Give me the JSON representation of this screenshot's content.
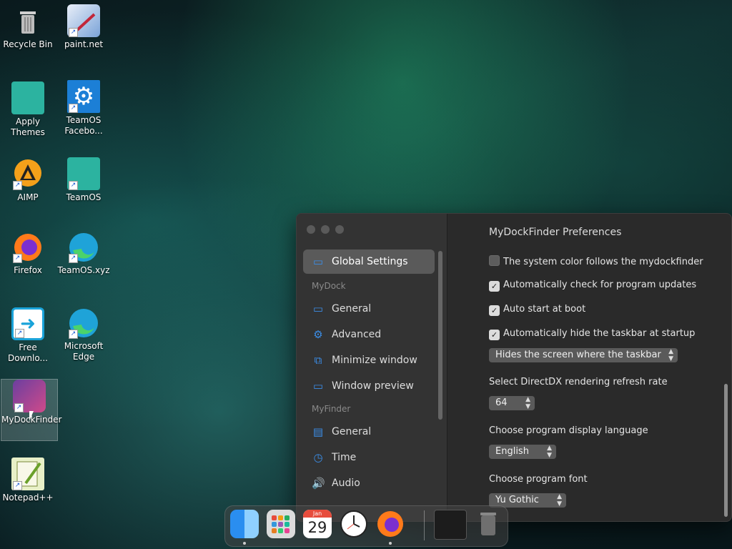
{
  "desktop": {
    "icons": [
      {
        "label": "Recycle Bin",
        "icon": "recycle-bin-icon"
      },
      {
        "label": "paint.net",
        "icon": "paint-net-icon"
      },
      {
        "label": "Apply Themes",
        "icon": "folder-icon"
      },
      {
        "label": "TeamOS Facebo...",
        "icon": "gear-icon"
      },
      {
        "label": "AIMP",
        "icon": "aimp-icon"
      },
      {
        "label": "TeamOS",
        "icon": "folder-icon"
      },
      {
        "label": "Firefox",
        "icon": "firefox-icon"
      },
      {
        "label": "TeamOS.xyz",
        "icon": "edge-icon"
      },
      {
        "label": "Free Downlo...",
        "icon": "free-download-manager-icon"
      },
      {
        "label": "Microsoft Edge",
        "icon": "edge-icon"
      },
      {
        "label": "MyDockFinder",
        "icon": "mydockfinder-icon"
      },
      {
        "label": "Notepad++",
        "icon": "notepad-plus-plus-icon"
      }
    ]
  },
  "window": {
    "title": "MyDockFinder Preferences",
    "sidebar": {
      "global": "Global Settings",
      "section_mydock": "MyDock",
      "mydock_items": [
        "General",
        "Advanced",
        "Minimize window",
        "Window preview"
      ],
      "section_myfinder": "MyFinder",
      "myfinder_items": [
        "General",
        "Time",
        "Audio"
      ]
    },
    "settings": {
      "system_color": {
        "label": "The system color follows the mydockfinder",
        "checked": false
      },
      "auto_update": {
        "label": "Automatically check for program updates",
        "checked": true
      },
      "auto_start": {
        "label": "Auto start at boot",
        "checked": true
      },
      "auto_hide": {
        "label": "Automatically hide the taskbar at startup",
        "checked": true
      },
      "hide_mode": "Hides the screen where the taskbar",
      "refresh_label": "Select DirectDX rendering refresh rate",
      "refresh_value": "64",
      "language_label": "Choose program display language",
      "language_value": "English",
      "font_label": "Choose program font",
      "font_value": "Yu Gothic"
    }
  },
  "dock": {
    "items": [
      "finder-icon",
      "launchpad-icon",
      "calendar-icon",
      "clock-icon",
      "firefox-icon",
      "window-preview-thumbnail",
      "trash-icon"
    ],
    "calendar_month": "Jan",
    "calendar_day": "29"
  },
  "colors": {
    "accent": "#3b8ee8",
    "window_bg": "#2a2a2a",
    "sidebar_bg": "#333333"
  }
}
